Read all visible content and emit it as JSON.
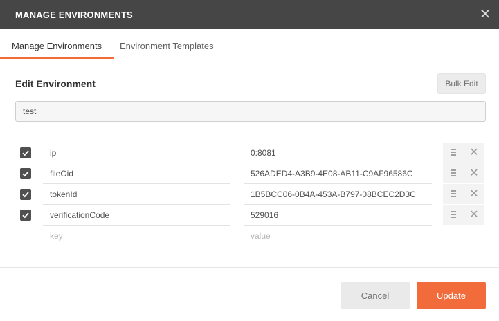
{
  "dialog": {
    "title": "MANAGE ENVIRONMENTS",
    "close_icon": "close-icon"
  },
  "tabs": [
    {
      "label": "Manage Environments",
      "active": true
    },
    {
      "label": "Environment Templates",
      "active": false
    }
  ],
  "editor": {
    "section_title": "Edit Environment",
    "bulk_edit_label": "Bulk Edit",
    "environment_name": "test"
  },
  "variables": [
    {
      "enabled": true,
      "key": "ip",
      "value": "0:8081"
    },
    {
      "enabled": true,
      "key": "fileOid",
      "value": "526ADED4-A3B9-4E08-AB11-C9AF96586C"
    },
    {
      "enabled": true,
      "key": "tokenId",
      "value": "1B5BCC06-0B4A-453A-B797-08BCEC2D3C"
    },
    {
      "enabled": true,
      "key": "verificationCode",
      "value": "529016"
    }
  ],
  "new_row": {
    "key_placeholder": "key",
    "value_placeholder": "value"
  },
  "footer": {
    "cancel_label": "Cancel",
    "update_label": "Update"
  },
  "colors": {
    "titlebar": "#464646",
    "accent": "#f26b3a",
    "checkbox": "#505050"
  }
}
